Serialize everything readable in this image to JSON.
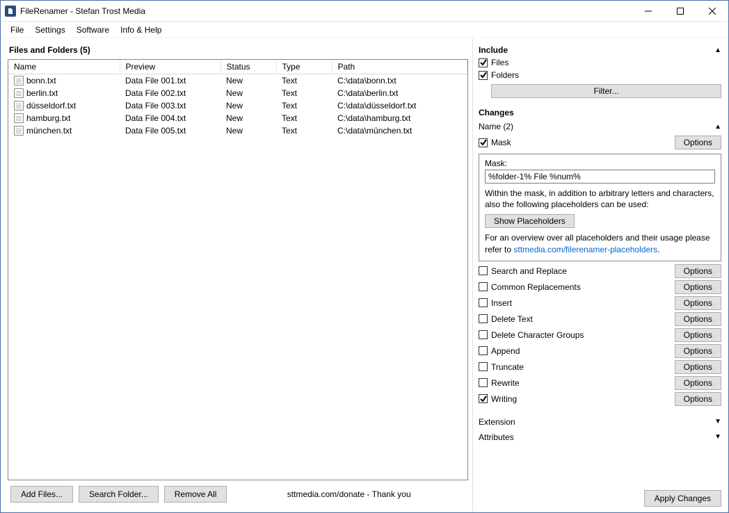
{
  "window": {
    "title": "FileRenamer - Stefan Trost Media"
  },
  "menu": {
    "file": "File",
    "settings": "Settings",
    "software": "Software",
    "info": "Info & Help"
  },
  "left": {
    "header": "Files and Folders (5)",
    "cols": {
      "name": "Name",
      "preview": "Preview",
      "status": "Status",
      "type": "Type",
      "path": "Path"
    },
    "rows": [
      {
        "name": "bonn.txt",
        "preview": "Data File 001.txt",
        "status": "New",
        "type": "Text",
        "path": "C:\\data\\bonn.txt"
      },
      {
        "name": "berlin.txt",
        "preview": "Data File 002.txt",
        "status": "New",
        "type": "Text",
        "path": "C:\\data\\berlin.txt"
      },
      {
        "name": "düsseldorf.txt",
        "preview": "Data File 003.txt",
        "status": "New",
        "type": "Text",
        "path": "C:\\data\\düsseldorf.txt"
      },
      {
        "name": "hamburg.txt",
        "preview": "Data File 004.txt",
        "status": "New",
        "type": "Text",
        "path": "C:\\data\\hamburg.txt"
      },
      {
        "name": "münchen.txt",
        "preview": "Data File 005.txt",
        "status": "New",
        "type": "Text",
        "path": "C:\\data\\münchen.txt"
      }
    ],
    "buttons": {
      "add": "Add Files...",
      "search": "Search Folder...",
      "remove": "Remove All"
    },
    "donate": "sttmedia.com/donate - Thank you"
  },
  "right": {
    "include": {
      "title": "Include",
      "files": "Files",
      "folders": "Folders",
      "filter": "Filter..."
    },
    "changes": {
      "title": "Changes",
      "name_section": "Name (2)",
      "mask_chk": "Mask",
      "options": "Options",
      "mask_label": "Mask:",
      "mask_value": "%folder-1% File %num%",
      "help1": "Within the mask, in addition to arbitrary letters and characters, also the following placeholders can be used:",
      "show_ph": "Show Placeholders",
      "help2a": "For an overview over all placeholders and their usage please refer to ",
      "help2link": "sttmedia.com/filerenamer-placeholders",
      "rows": [
        {
          "label": "Search and Replace",
          "checked": false
        },
        {
          "label": "Common Replacements",
          "checked": false
        },
        {
          "label": "Insert",
          "checked": false
        },
        {
          "label": "Delete Text",
          "checked": false
        },
        {
          "label": "Delete Character Groups",
          "checked": false
        },
        {
          "label": "Append",
          "checked": false
        },
        {
          "label": "Truncate",
          "checked": false
        },
        {
          "label": "Rewrite",
          "checked": false
        },
        {
          "label": "Writing",
          "checked": true
        }
      ],
      "extension": "Extension",
      "attributes": "Attributes"
    },
    "apply": "Apply Changes"
  }
}
